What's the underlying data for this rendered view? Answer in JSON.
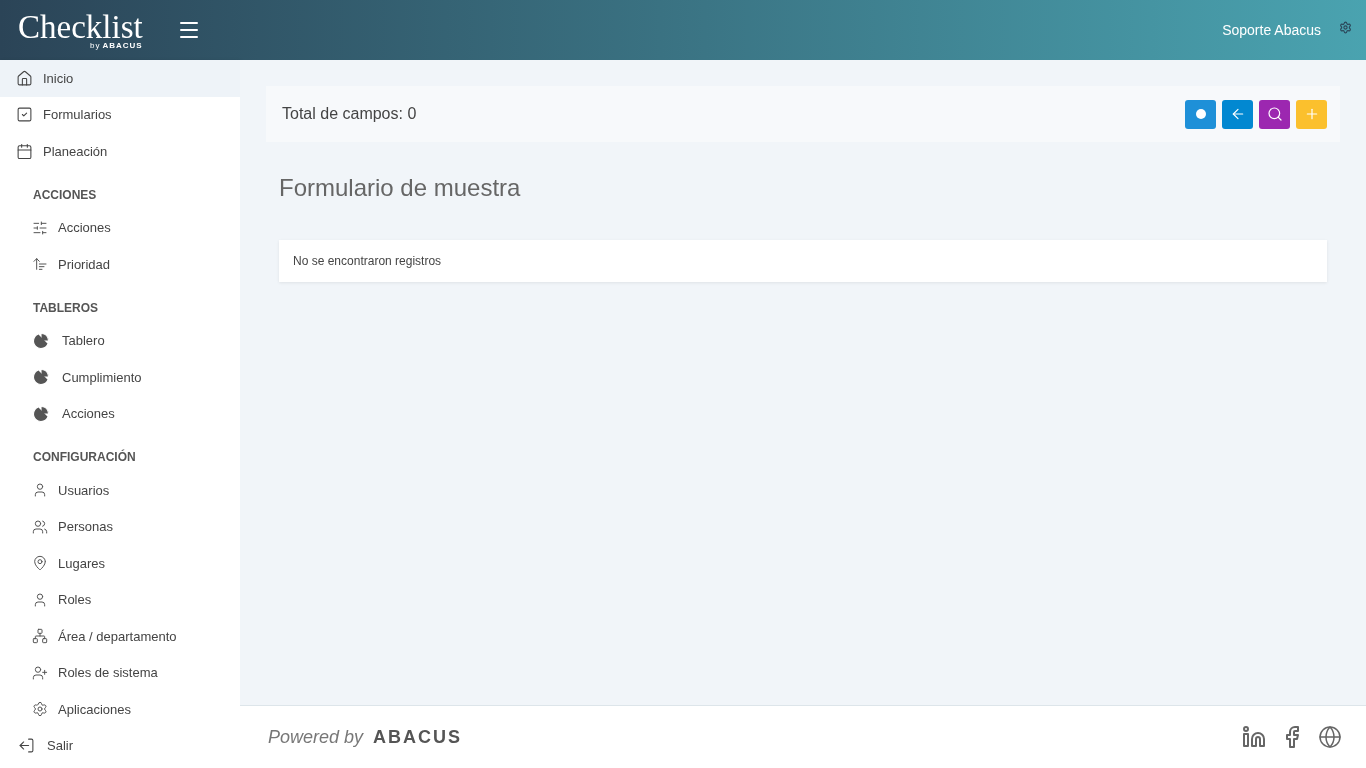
{
  "header": {
    "logo_title": "Checklist",
    "logo_by": "by",
    "logo_brand": "ABACUS",
    "user": "Soporte Abacus"
  },
  "sidebar": {
    "items": [
      {
        "label": "Inicio",
        "selected": true
      },
      {
        "label": "Formularios",
        "selected": false
      },
      {
        "label": "Planeación",
        "selected": false
      }
    ],
    "sections": [
      {
        "title": "ACCIONES",
        "items": [
          {
            "label": "Acciones",
            "selected": false
          },
          {
            "label": "Prioridad",
            "selected": false
          }
        ]
      },
      {
        "title": "TABLEROS",
        "items": [
          {
            "label": "Tablero",
            "selected": false
          },
          {
            "label": "Cumplimiento",
            "selected": false
          },
          {
            "label": "Acciones",
            "selected": false
          }
        ]
      },
      {
        "title": "CONFIGURACIÓN",
        "items": [
          {
            "label": "Usuarios",
            "selected": false
          },
          {
            "label": "Personas",
            "selected": false
          },
          {
            "label": "Lugares",
            "selected": false
          },
          {
            "label": "Roles",
            "selected": false
          },
          {
            "label": "Área / departamento",
            "selected": false
          },
          {
            "label": "Roles de sistema",
            "selected": false
          },
          {
            "label": "Aplicaciones",
            "selected": false
          }
        ]
      }
    ],
    "logout": "Salir"
  },
  "toolbar": {
    "total": "Total de campos: 0",
    "buttons": [
      {
        "color": "#1e90d8"
      },
      {
        "color": "#0288d1"
      },
      {
        "color": "#9c27b0"
      },
      {
        "color": "#fbc02d"
      }
    ]
  },
  "page_title": "Formulario de muestra",
  "empty_message": "No se encontraron registros",
  "footer": {
    "powered": "Powered by",
    "brand": "ABACUS"
  }
}
